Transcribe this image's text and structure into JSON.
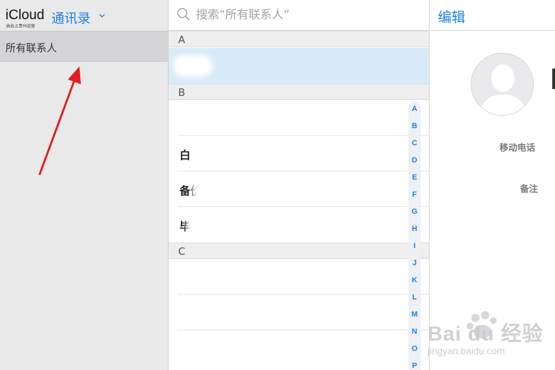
{
  "sidebar": {
    "brand_name": "iCloud",
    "brand_subtitle": "由云上贵州运营",
    "app_name": "通讯录",
    "groups": [
      {
        "label": "所有联系人",
        "selected": true
      }
    ]
  },
  "search": {
    "placeholder": "搜索“所有联系人”"
  },
  "contacts": {
    "sections": [
      {
        "letter": "A"
      },
      {
        "letter": "B"
      },
      {
        "letter": "C"
      }
    ],
    "visible_names": {
      "b2": "白",
      "b3": "备份",
      "b4": "毕"
    },
    "alphabet_index": [
      "A",
      "B",
      "C",
      "D",
      "E",
      "F",
      "G",
      "H",
      "I",
      "J",
      "K",
      "L",
      "M",
      "N",
      "O",
      "P"
    ]
  },
  "detail": {
    "edit_label": "编辑",
    "fields": {
      "mobile_label": "移动电话",
      "notes_label": "备注"
    }
  },
  "watermark": {
    "brand": "Bai du 经验",
    "url": "jingyan.baidu.com"
  },
  "colors": {
    "accent": "#1a83e5",
    "selected_row": "#d8ebf9",
    "sidebar_bg": "#e9e9ea",
    "annotation_arrow": "#e02020"
  }
}
